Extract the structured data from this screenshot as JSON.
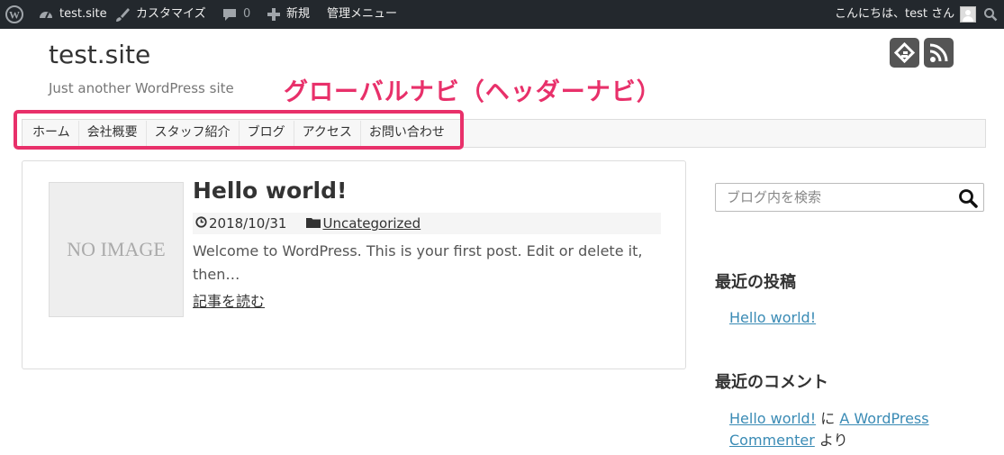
{
  "admin_bar": {
    "site_name": "test.site",
    "customize": "カスタマイズ",
    "comments_count": "0",
    "new": "新規",
    "admin_menu": "管理メニュー",
    "greeting": "こんにちは、test さん"
  },
  "header": {
    "site_title": "test.site",
    "tagline": "Just another WordPress site",
    "annotation": "グローバルナビ（ヘッダーナビ）"
  },
  "nav": {
    "items": [
      "ホーム",
      "会社概要",
      "スタッフ紹介",
      "ブログ",
      "アクセス",
      "お問い合わせ"
    ]
  },
  "post": {
    "thumbnail_text": "NO IMAGE",
    "title": "Hello world!",
    "date": "2018/10/31",
    "category": "Uncategorized",
    "excerpt": "Welcome to WordPress. This is your first post. Edit or delete it, then…",
    "read_more": "記事を読む"
  },
  "sidebar": {
    "search_placeholder": "ブログ内を検索",
    "recent_posts_title": "最近の投稿",
    "recent_posts": [
      "Hello world!"
    ],
    "recent_comments_title": "最近のコメント",
    "recent_comment": {
      "post": "Hello world!",
      "on": "に",
      "author": "A WordPress Commenter",
      "from": "より"
    }
  },
  "colors": {
    "accent": "#e8306a",
    "link": "#3a8bb5",
    "admin_bar_bg": "#23282d"
  }
}
